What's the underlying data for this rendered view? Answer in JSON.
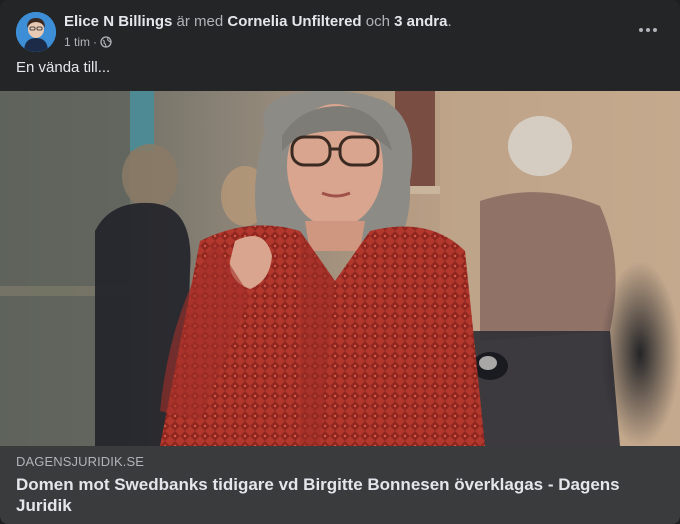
{
  "post": {
    "author": "Elice N Billings",
    "with_word": "är med",
    "tagged": "Cornelia Unfiltered",
    "and_word": "och",
    "others": "3 andra",
    "period": ".",
    "time": "1 tim",
    "separator": "·",
    "privacy_icon": "globe-icon",
    "more_icon": "ellipsis-icon",
    "text": "En vända till..."
  },
  "link": {
    "domain": "DAGENSJURIDIK.SE",
    "title": "Domen mot Swedbanks tidigare vd Birgitte Bonnesen överklagas - Dagens Juridik"
  },
  "colors": {
    "card_bg": "#242526",
    "link_bg": "#3a3b3c",
    "primary_text": "#e4e6eb",
    "secondary_text": "#b0b3b8"
  }
}
